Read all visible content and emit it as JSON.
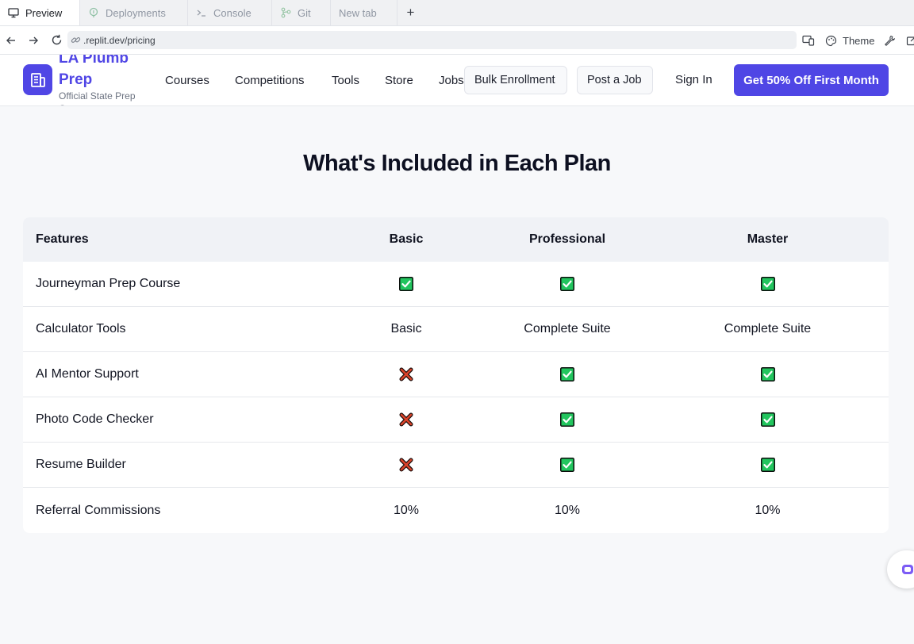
{
  "browser": {
    "tabs": [
      {
        "label": "Preview",
        "icon": "monitor-icon",
        "active": true
      },
      {
        "label": "Deployments",
        "icon": "deployments-icon",
        "active": false
      },
      {
        "label": "Console",
        "icon": "console-icon",
        "active": false
      },
      {
        "label": "Git",
        "icon": "git-icon",
        "active": false
      },
      {
        "label": "New tab",
        "icon": "",
        "active": false
      }
    ],
    "new_tab_label": "+",
    "url": ".replit.dev/pricing",
    "theme_label": "Theme"
  },
  "header": {
    "brand_name": "LA Plumb Prep",
    "brand_sub": "Official State Prep Course",
    "nav": [
      "Courses",
      "Competitions",
      "Tools",
      "Store",
      "Jobs"
    ],
    "bulk_label": "Bulk Enrollment",
    "post_job_label": "Post a Job",
    "signin_label": "Sign In",
    "cta_label": "Get 50% Off First Month",
    "accent": "#4f46e5"
  },
  "comparison": {
    "title": "What's Included in Each Plan",
    "columns": [
      "Features",
      "Basic",
      "Professional",
      "Master"
    ],
    "rows": [
      {
        "feature": "Journeyman Prep Course",
        "values": [
          "check",
          "check",
          "check"
        ]
      },
      {
        "feature": "Calculator Tools",
        "values": [
          "Basic",
          "Complete Suite",
          "Complete Suite"
        ]
      },
      {
        "feature": "AI Mentor Support",
        "values": [
          "cross",
          "check",
          "check"
        ]
      },
      {
        "feature": "Photo Code Checker",
        "values": [
          "cross",
          "check",
          "check"
        ]
      },
      {
        "feature": "Resume Builder",
        "values": [
          "cross",
          "check",
          "check"
        ]
      },
      {
        "feature": "Referral Commissions",
        "values": [
          "10%",
          "10%",
          "10%"
        ]
      }
    ],
    "check_color": "#22c55e",
    "cross_color": "#d9432a"
  }
}
